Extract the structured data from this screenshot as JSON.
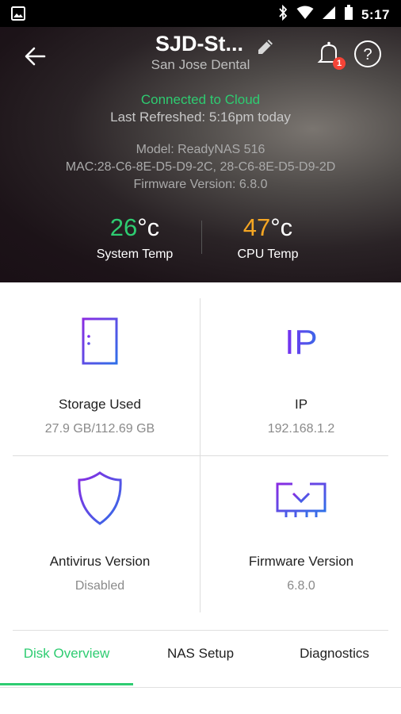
{
  "status_bar": {
    "time": "5:17",
    "icons": [
      "image-icon",
      "bluetooth-icon",
      "wifi-icon",
      "signal-icon",
      "battery-icon"
    ]
  },
  "header": {
    "title": "SJD-St...",
    "subtitle": "San Jose Dental",
    "notification_count": "1",
    "icons": [
      "back-arrow-icon",
      "pencil-icon",
      "bell-icon",
      "help-icon"
    ]
  },
  "device_info": {
    "connection_status": "Connected to Cloud",
    "last_refreshed": "Last Refreshed: 5:16pm today",
    "model": "Model: ReadyNAS 516",
    "mac": "MAC:28-C6-8E-D5-D9-2C, 28-C6-8E-D5-D9-2D",
    "firmware": "Firmware Version: 6.8.0"
  },
  "temps": {
    "system": {
      "value": "26",
      "unit": "°c",
      "label": "System Temp",
      "color": "#2ecc71"
    },
    "cpu": {
      "value": "47",
      "unit": "°c",
      "label": "CPU Temp",
      "color": "#f5a623"
    }
  },
  "cards": [
    {
      "label": "Storage Used",
      "value": "27.9 GB/112.69 GB",
      "icon": "storage-icon"
    },
    {
      "label": "IP",
      "value": "192.168.1.2",
      "icon_text": "IP",
      "icon": "ip-icon"
    },
    {
      "label": "Antivirus Version",
      "value": "Disabled",
      "icon": "shield-icon"
    },
    {
      "label": "Firmware Version",
      "value": "6.8.0",
      "icon": "firmware-download-icon"
    }
  ],
  "tabs": [
    {
      "label": "Disk Overview",
      "active": true
    },
    {
      "label": "NAS Setup",
      "active": false
    },
    {
      "label": "Diagnostics",
      "active": false
    }
  ],
  "colors": {
    "accent_green": "#2ecc71",
    "accent_orange": "#f5a623",
    "icon_gradient_start": "#7a2cf0",
    "icon_gradient_end": "#3a6ae8",
    "badge_red": "#f44336"
  }
}
